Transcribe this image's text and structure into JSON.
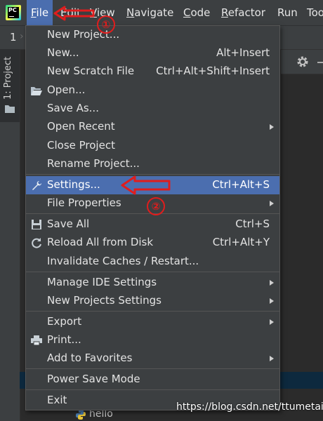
{
  "menubar": {
    "items": [
      {
        "label": "File",
        "mnemonic": "F"
      },
      {
        "label": "Edit"
      },
      {
        "label": "View",
        "mnemonic": "V"
      },
      {
        "label": "Navigate",
        "mnemonic": "N"
      },
      {
        "label": "Code",
        "mnemonic": "C"
      },
      {
        "label": "Refactor",
        "mnemonic": "R"
      },
      {
        "label": "Run"
      },
      {
        "label": "Too"
      }
    ]
  },
  "navbar": {
    "number": "1"
  },
  "toolwindow": {
    "project_label": "1: Project"
  },
  "file_menu": {
    "rows": [
      {
        "label": "New Project..."
      },
      {
        "label": "New...",
        "shortcut": "Alt+Insert"
      },
      {
        "label": "New Scratch File",
        "shortcut": "Ctrl+Alt+Shift+Insert"
      },
      {
        "label": "Open..."
      },
      {
        "label": "Save As..."
      },
      {
        "label": "Open Recent"
      },
      {
        "label": "Close Project"
      },
      {
        "label": "Rename Project..."
      },
      {
        "label": "Settings...",
        "shortcut": "Ctrl+Alt+S"
      },
      {
        "label": "File Properties"
      },
      {
        "label": "Save All",
        "shortcut": "Ctrl+S"
      },
      {
        "label": "Reload All from Disk",
        "shortcut": "Ctrl+Alt+Y"
      },
      {
        "label": "Invalidate Caches / Restart..."
      },
      {
        "label": "Manage IDE Settings"
      },
      {
        "label": "New Projects Settings"
      },
      {
        "label": "Export"
      },
      {
        "label": "Print..."
      },
      {
        "label": "Add to Favorites"
      },
      {
        "label": "Power Save Mode"
      },
      {
        "label": "Exit"
      }
    ]
  },
  "annotations": {
    "step1": "①",
    "step2": "②"
  },
  "project_tree": {
    "file_label": "hello"
  },
  "watermark": "https://blog.csdn.net/ttumetai",
  "colors": {
    "highlight": "#4b6eaf",
    "menu_bg": "#3c3f41",
    "annotation": "#e01d1d"
  }
}
